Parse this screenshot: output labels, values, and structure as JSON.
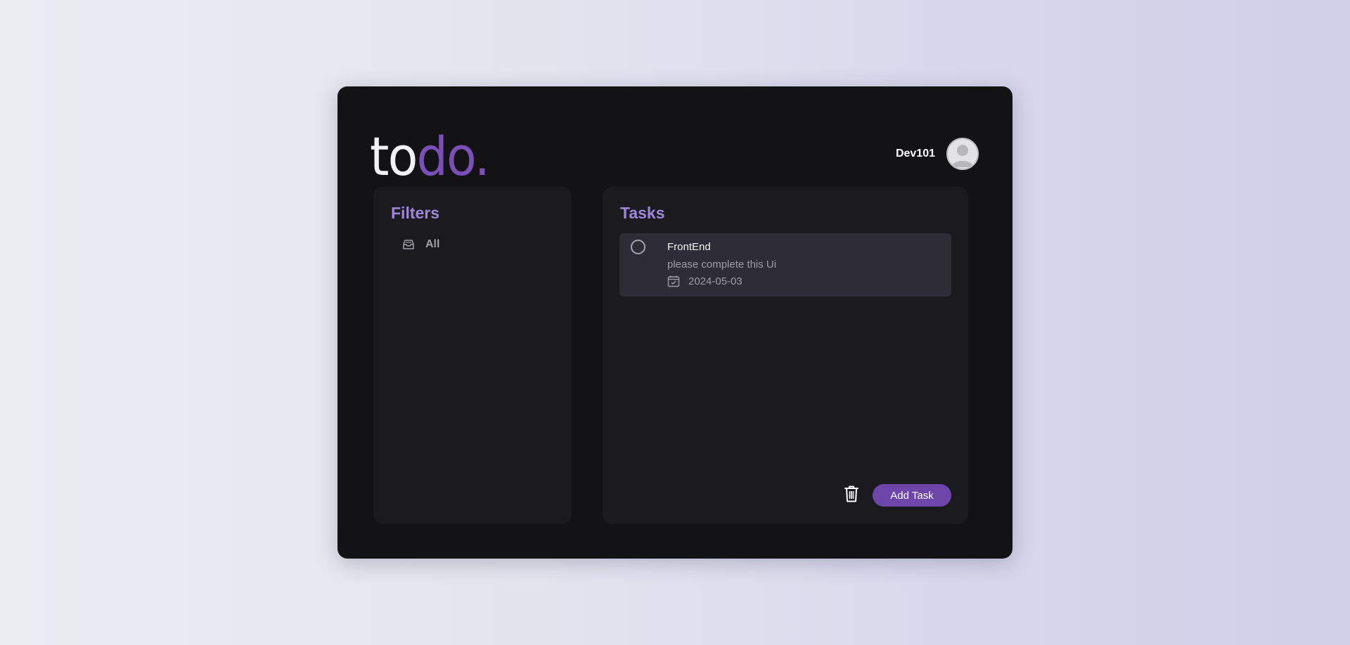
{
  "logo": {
    "part1": "to",
    "part2": "do."
  },
  "user": {
    "name": "Dev101"
  },
  "filters": {
    "title": "Filters",
    "items": [
      {
        "label": "All",
        "icon": "inbox-icon"
      }
    ]
  },
  "tasks": {
    "title": "Tasks",
    "items": [
      {
        "title": "FrontEnd",
        "description": "please complete this Ui",
        "date": "2024-05-03"
      }
    ],
    "add_label": "Add Task"
  },
  "colors": {
    "accent": "#6e46aa",
    "heading": "#9e87d9",
    "app_bg": "#131316",
    "panel_bg": "#1b1a1f",
    "card_bg": "#2e2c36"
  }
}
